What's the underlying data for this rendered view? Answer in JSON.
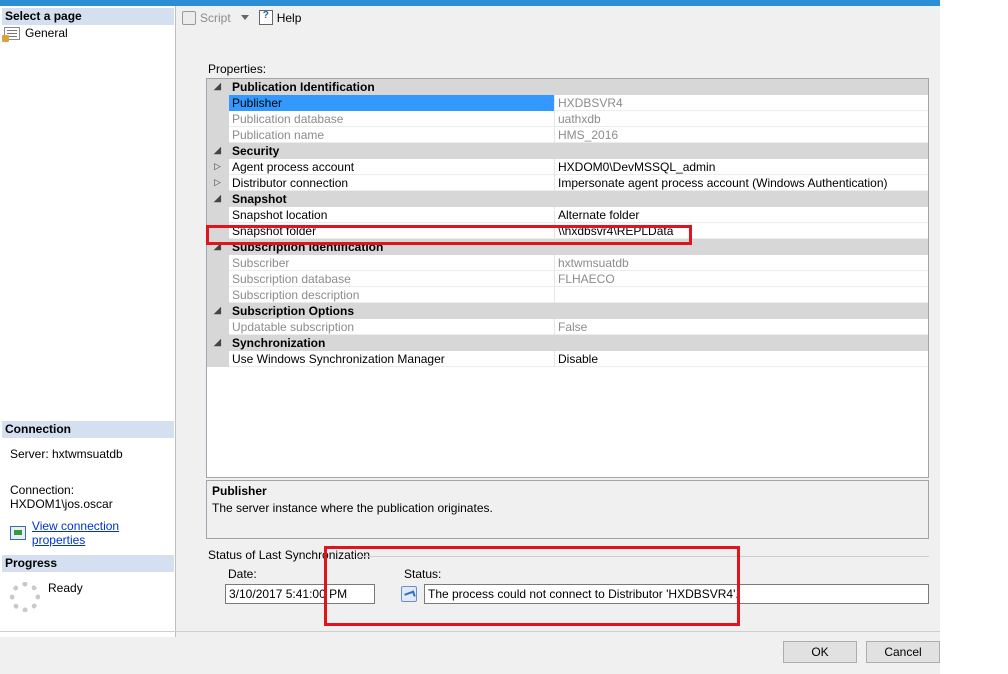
{
  "left_pane": {
    "select_page_header": "Select a page",
    "pages": [
      {
        "label": "General",
        "icon": "general-page-icon"
      }
    ],
    "connection_header": "Connection",
    "server_text": "Server: hxtwmsuatdb",
    "connection_text": "Connection: HXDOM1\\jos.oscar",
    "view_connection_link": "View connection properties",
    "progress_header": "Progress",
    "progress_status": "Ready"
  },
  "toolbar": {
    "script_label": "Script",
    "help_label": "Help"
  },
  "properties": {
    "label": "Properties:",
    "rows": [
      {
        "kind": "category",
        "name": "Publication Identification"
      },
      {
        "kind": "prop",
        "name": "Publisher",
        "value": "HXDBSVR4",
        "readonly": true,
        "selected": true
      },
      {
        "kind": "prop",
        "name": "Publication database",
        "value": "uathxdb",
        "readonly": true
      },
      {
        "kind": "prop",
        "name": "Publication name",
        "value": "HMS_2016",
        "readonly": true
      },
      {
        "kind": "category",
        "name": "Security"
      },
      {
        "kind": "prop",
        "name": "Agent process account",
        "value": "HXDOM0\\DevMSSQL_admin",
        "expandable": true
      },
      {
        "kind": "prop",
        "name": "Distributor connection",
        "value": "Impersonate agent process account (Windows Authentication)",
        "expandable": true
      },
      {
        "kind": "category",
        "name": "Snapshot"
      },
      {
        "kind": "prop",
        "name": "Snapshot location",
        "value": "Alternate folder"
      },
      {
        "kind": "prop",
        "name": "Snapshot folder",
        "value": "\\\\hxdbsvr4\\REPLData"
      },
      {
        "kind": "category",
        "name": "Subscription Identification"
      },
      {
        "kind": "prop",
        "name": "Subscriber",
        "value": "hxtwmsuatdb",
        "readonly": true
      },
      {
        "kind": "prop",
        "name": "Subscription database",
        "value": "FLHAECO",
        "readonly": true
      },
      {
        "kind": "prop",
        "name": "Subscription description",
        "value": "",
        "readonly": true
      },
      {
        "kind": "category",
        "name": "Subscription Options"
      },
      {
        "kind": "prop",
        "name": "Updatable subscription",
        "value": "False",
        "readonly": true
      },
      {
        "kind": "category",
        "name": "Synchronization"
      },
      {
        "kind": "prop",
        "name": "Use Windows Synchronization Manager",
        "value": "Disable"
      }
    ]
  },
  "description": {
    "title": "Publisher",
    "text": "The server instance where the publication originates."
  },
  "status_section": {
    "group_label": "Status of Last Synchronization",
    "date_label": "Date:",
    "date_value": "3/10/2017 5:41:00 PM",
    "status_label": "Status:",
    "status_value": "The process could not connect to Distributor 'HXDBSVR4'."
  },
  "buttons": {
    "ok": "OK",
    "cancel": "Cancel"
  },
  "colors": {
    "accent": "#2c8fd6",
    "selection": "#3399ff",
    "annotation": "#e0141c"
  }
}
